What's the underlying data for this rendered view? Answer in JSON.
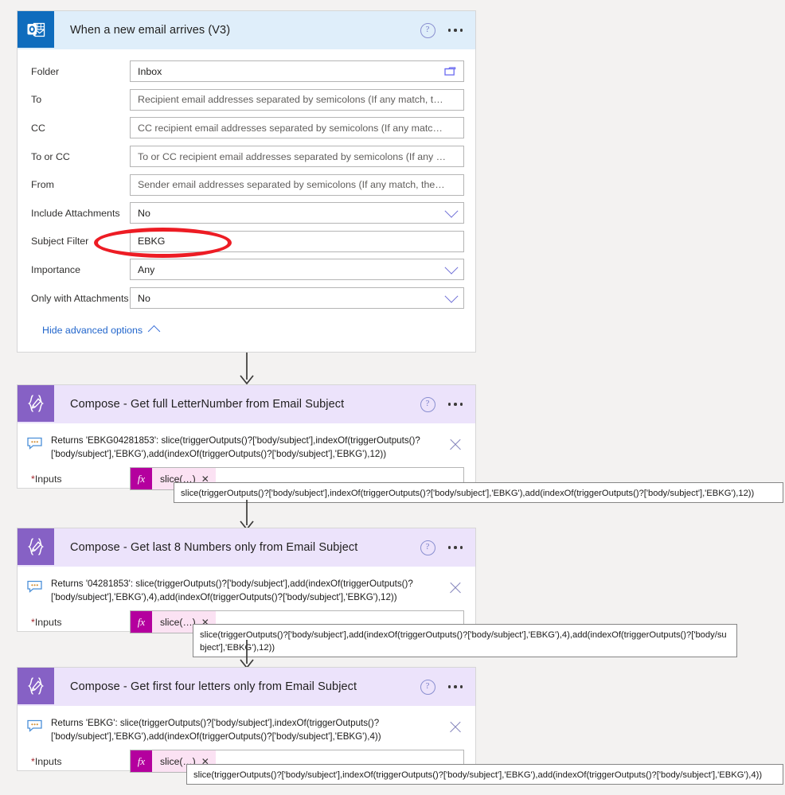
{
  "trigger": {
    "icon": "outlook-icon",
    "title": "When a new email arrives (V3)",
    "help_icon": "help-circle-icon",
    "more_icon": "more-options-icon",
    "fields": [
      {
        "label": "Folder",
        "value": "Inbox",
        "is_placeholder": false,
        "control": "folder-picker"
      },
      {
        "label": "To",
        "value": "Recipient email addresses separated by semicolons (If any match, t…",
        "is_placeholder": true,
        "control": "text"
      },
      {
        "label": "CC",
        "value": "CC recipient email addresses separated by semicolons (If any matc…",
        "is_placeholder": true,
        "control": "text"
      },
      {
        "label": "To or CC",
        "value": "To or CC recipient email addresses separated by semicolons (If any …",
        "is_placeholder": true,
        "control": "text"
      },
      {
        "label": "From",
        "value": "Sender email addresses separated by semicolons (If any match, the…",
        "is_placeholder": true,
        "control": "text"
      },
      {
        "label": "Include Attachments",
        "value": "No",
        "is_placeholder": false,
        "control": "dropdown"
      },
      {
        "label": "Subject Filter",
        "value": "EBKG",
        "is_placeholder": false,
        "control": "text"
      },
      {
        "label": "Importance",
        "value": "Any",
        "is_placeholder": false,
        "control": "dropdown"
      },
      {
        "label": "Only with Attachments",
        "value": "No",
        "is_placeholder": false,
        "control": "dropdown"
      }
    ],
    "advanced_options_label": "Hide advanced options",
    "advanced_caret_icon": "chevron-up-icon"
  },
  "annotation": {
    "color": "#ed1c24",
    "shape": "ellipse",
    "targets": "subject-filter-field"
  },
  "compose_steps": [
    {
      "icon": "compose-icon",
      "title": "Compose - Get full LetterNumber from Email Subject",
      "help_icon": "help-circle-icon",
      "more_icon": "more-options-icon",
      "comment_icon": "comment-bubble-icon",
      "returns_text": "Returns 'EBKG04281853': slice(triggerOutputs()?['body/subject'],indexOf(triggerOutputs()?['body/subject'],'EBKG'),add(indexOf(triggerOutputs()?['body/subject'],'EBKG'),12))",
      "close_icon": "close-icon",
      "inputs_label": "Inputs",
      "inputs_required_mark": "*",
      "fx_badge": "fx",
      "token_label": "slice(…)",
      "token_remove_icon": "remove-token-icon",
      "tooltip": "slice(triggerOutputs()?['body/subject'],indexOf(triggerOutputs()?['body/subject'],'EBKG'),add(indexOf(triggerOutputs()?['body/subject'],'EBKG'),12))"
    },
    {
      "icon": "compose-icon",
      "title": "Compose - Get last 8 Numbers only from Email Subject",
      "help_icon": "help-circle-icon",
      "more_icon": "more-options-icon",
      "comment_icon": "comment-bubble-icon",
      "returns_text": "Returns '04281853': slice(triggerOutputs()?['body/subject'],add(indexOf(triggerOutputs()?['body/subject'],'EBKG'),4),add(indexOf(triggerOutputs()?['body/subject'],'EBKG'),12))",
      "close_icon": "close-icon",
      "inputs_label": "Inputs",
      "inputs_required_mark": "*",
      "fx_badge": "fx",
      "token_label": "slice(…)",
      "token_remove_icon": "remove-token-icon",
      "tooltip": "slice(triggerOutputs()?['body/subject'],add(indexOf(triggerOutputs()?['body/subject'],'EBKG'),4),add(indexOf(triggerOutputs()?['body/subject'],'EBKG'),12))"
    },
    {
      "icon": "compose-icon",
      "title": "Compose - Get first four letters only from Email Subject",
      "help_icon": "help-circle-icon",
      "more_icon": "more-options-icon",
      "comment_icon": "comment-bubble-icon",
      "returns_text": "Returns 'EBKG': slice(triggerOutputs()?['body/subject'],indexOf(triggerOutputs()?['body/subject'],'EBKG'),add(indexOf(triggerOutputs()?['body/subject'],'EBKG'),4))",
      "close_icon": "close-icon",
      "inputs_label": "Inputs",
      "inputs_required_mark": "*",
      "fx_badge": "fx",
      "token_label": "slice(…)",
      "token_remove_icon": "remove-token-icon",
      "tooltip": "slice(triggerOutputs()?['body/subject'],indexOf(triggerOutputs()?['body/subject'],'EBKG'),add(indexOf(triggerOutputs()?['body/subject'],'EBKG'),4))"
    }
  ],
  "connectors": [
    {
      "name": "connector-trigger-to-compose-1"
    },
    {
      "name": "connector-compose-1-to-compose-2"
    },
    {
      "name": "connector-compose-2-to-compose-3"
    }
  ]
}
